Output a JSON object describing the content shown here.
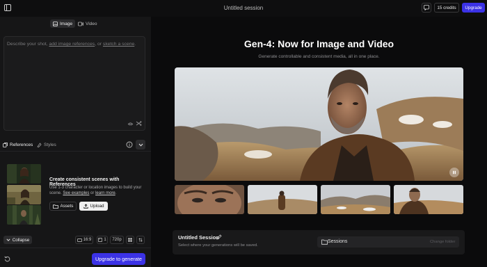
{
  "header": {
    "title": "Untitled session",
    "credits_label": "15 credits",
    "upgrade_label": "Upgrade"
  },
  "mode_tabs": [
    {
      "label": "Image",
      "icon": "image-icon",
      "active": true
    },
    {
      "label": "Video",
      "icon": "video-icon",
      "active": false
    }
  ],
  "prompt": {
    "text_1": "Describe your shot, ",
    "link_1": "add image references",
    "text_2": ", or ",
    "link_2": "sketch a scene",
    "text_3": "."
  },
  "ref_tabs": [
    {
      "label": "References",
      "icon": "references-icon",
      "active": true
    },
    {
      "label": "Styles",
      "icon": "styles-icon",
      "active": false
    }
  ],
  "references": {
    "title": "Create consistent scenes with References",
    "desc_1": "Use 1-3 character or location images to build your scene. ",
    "examples_link": "See examples",
    "desc_2": " or ",
    "learn_link": "learn more",
    "desc_3": ".",
    "assets_label": "Assets",
    "upload_label": "Upload"
  },
  "footer_controls": {
    "collapse_label": "Collapse",
    "aspect": "16:9",
    "count": "1",
    "resolution": "720p"
  },
  "generate_label": "Upgrade to generate",
  "main": {
    "heading": "Gen-4: Now for Image and Video",
    "subheading": "Generate controllable and consistent media, all in one place."
  },
  "session": {
    "title": "Untitled Session",
    "description": "Select where your generations will be saved.",
    "folder_label": "Sessions",
    "change_label": "Change folder"
  },
  "colors": {
    "accent": "#3b32e6",
    "panel": "#161617",
    "background": "#0b0b0c"
  }
}
